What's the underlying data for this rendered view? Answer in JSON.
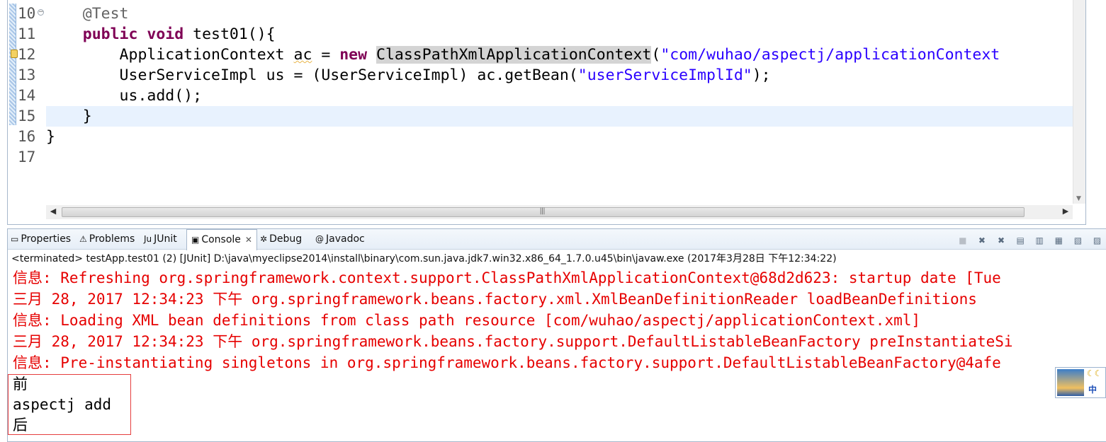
{
  "editor": {
    "lines": [
      {
        "num": "10",
        "parts": [
          {
            "t": "    "
          },
          {
            "t": "@Test",
            "c": "ann"
          }
        ]
      },
      {
        "num": "11",
        "parts": [
          {
            "t": "    "
          },
          {
            "t": "public",
            "c": "kw"
          },
          {
            "t": " "
          },
          {
            "t": "void",
            "c": "kw"
          },
          {
            "t": " test01(){"
          }
        ]
      },
      {
        "num": "12",
        "parts": [
          {
            "t": "        ApplicationContext "
          },
          {
            "t": "ac",
            "c": "warn-u"
          },
          {
            "t": " = "
          },
          {
            "t": "new",
            "c": "kw"
          },
          {
            "t": " "
          },
          {
            "t": "ClassPathXmlApplicationContext",
            "c": "hl"
          },
          {
            "t": "("
          },
          {
            "t": "\"com/wuhao/aspectj/applicationContext",
            "c": "str"
          }
        ]
      },
      {
        "num": "13",
        "parts": [
          {
            "t": "        UserServiceImpl us = (UserServiceImpl) ac.getBean("
          },
          {
            "t": "\"userServiceImplId\"",
            "c": "str"
          },
          {
            "t": ");"
          }
        ]
      },
      {
        "num": "14",
        "parts": [
          {
            "t": "        us.add();"
          }
        ]
      },
      {
        "num": "15",
        "parts": [
          {
            "t": "    }"
          }
        ],
        "current": true
      },
      {
        "num": "16",
        "parts": [
          {
            "t": "}"
          }
        ]
      },
      {
        "num": "17",
        "parts": []
      }
    ]
  },
  "panel": {
    "tabs": [
      {
        "label": "Properties",
        "icon": "properties-icon",
        "glyph": "▭"
      },
      {
        "label": "Problems",
        "icon": "problems-icon",
        "glyph": "⚠"
      },
      {
        "label": "JUnit",
        "icon": "junit-icon",
        "glyph": "Ju"
      },
      {
        "label": "Console",
        "icon": "console-icon",
        "glyph": "▣",
        "active": true
      },
      {
        "label": "Debug",
        "icon": "debug-icon",
        "glyph": "✲"
      },
      {
        "label": "Javadoc",
        "icon": "javadoc-icon",
        "glyph": "@"
      }
    ],
    "status": "<terminated> testApp.test01 (2) [JUnit] D:\\java\\myeclipse2014\\install\\binary\\com.sun.java.jdk7.win32.x86_64_1.7.0.u45\\bin\\javaw.exe (2017年3月28日 下午12:34:22)",
    "console_lines": [
      "信息: Refreshing org.springframework.context.support.ClassPathXmlApplicationContext@68d2d623: startup date [Tue",
      "三月 28, 2017 12:34:23 下午 org.springframework.beans.factory.xml.XmlBeanDefinitionReader loadBeanDefinitions",
      "信息: Loading XML bean definitions from class path resource [com/wuhao/aspectj/applicationContext.xml]",
      "三月 28, 2017 12:34:23 下午 org.springframework.beans.factory.support.DefaultListableBeanFactory preInstantiateSi",
      "信息: Pre-instantiating singletons in org.springframework.beans.factory.support.DefaultListableBeanFactory@4afe"
    ],
    "output_lines": [
      "前",
      "aspectj add",
      "后"
    ]
  },
  "ime": {
    "lang": "中"
  }
}
